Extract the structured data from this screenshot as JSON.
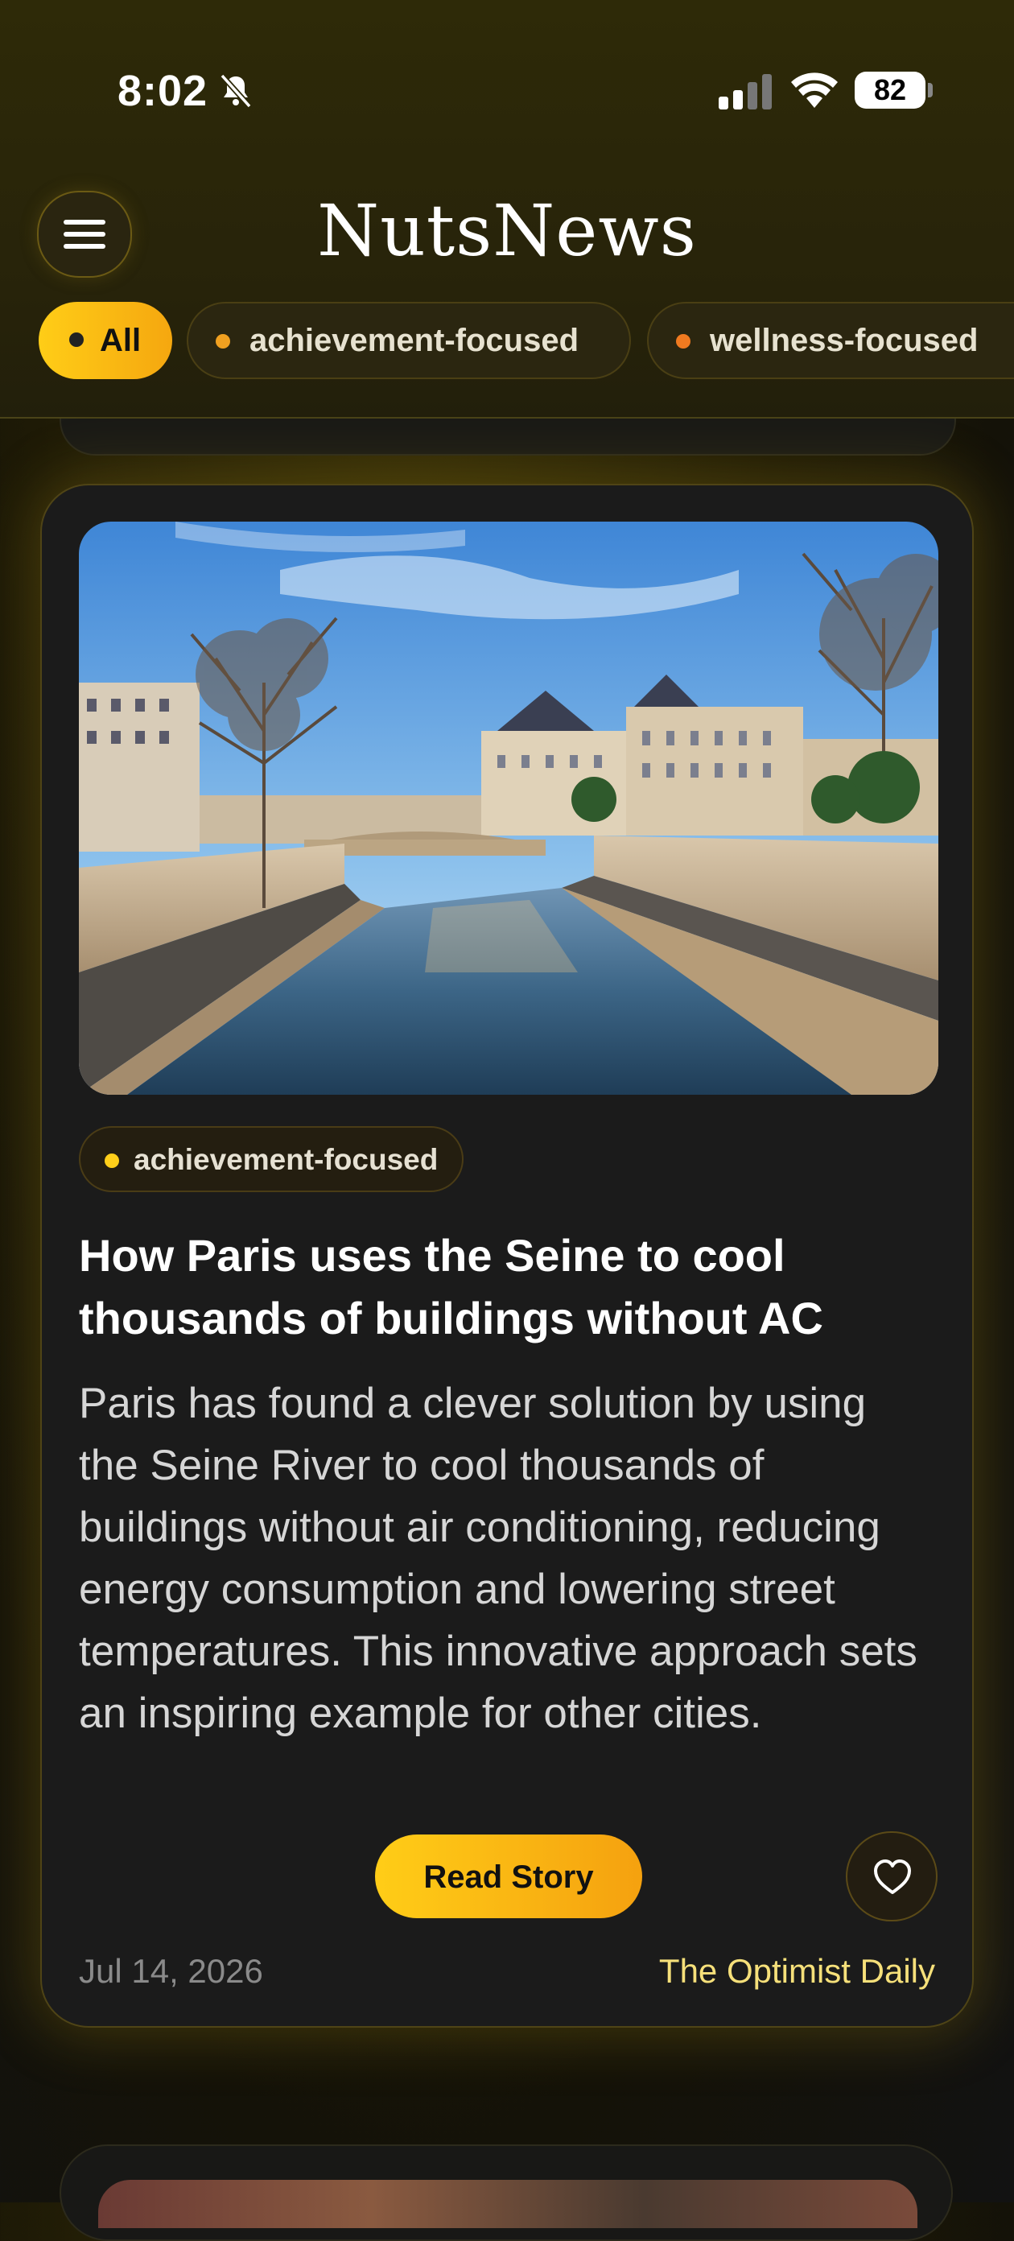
{
  "status_bar": {
    "time": "8:02",
    "battery": "82",
    "icons": [
      "bell-slash-icon",
      "cellular-signal-icon",
      "wifi-icon",
      "battery-icon"
    ]
  },
  "header": {
    "menu_icon": "hamburger-menu-icon",
    "brand": "NutsNews"
  },
  "filters": [
    {
      "label": "All",
      "active": true
    },
    {
      "label": "achievement-focused",
      "active": false
    },
    {
      "label": "wellness-focused",
      "active": false
    }
  ],
  "article": {
    "image_alt": "River Seine in Paris with bridge, stone quays, bare trees and Haussmann buildings under a blue sky",
    "tag": "achievement-focused",
    "headline": "How Paris uses the Seine to cool thousands of buildings without AC",
    "summary": "Paris has found a clever solution by using the Seine River to cool thousands of buildings without air conditioning, reducing energy consumption and lowering street temperatures. This innovative approach sets an inspiring example for other cities.",
    "read_button": "Read Story",
    "favorite_icon": "heart-icon",
    "date": "Jul 14, 2026",
    "source": "The Optimist Daily"
  },
  "colors": {
    "accent": "#FFC917",
    "accent_end": "#F5A10F",
    "card_bg": "#1B1B1B",
    "source_text": "#F6E07A",
    "dot_orange": "#F0A020"
  }
}
